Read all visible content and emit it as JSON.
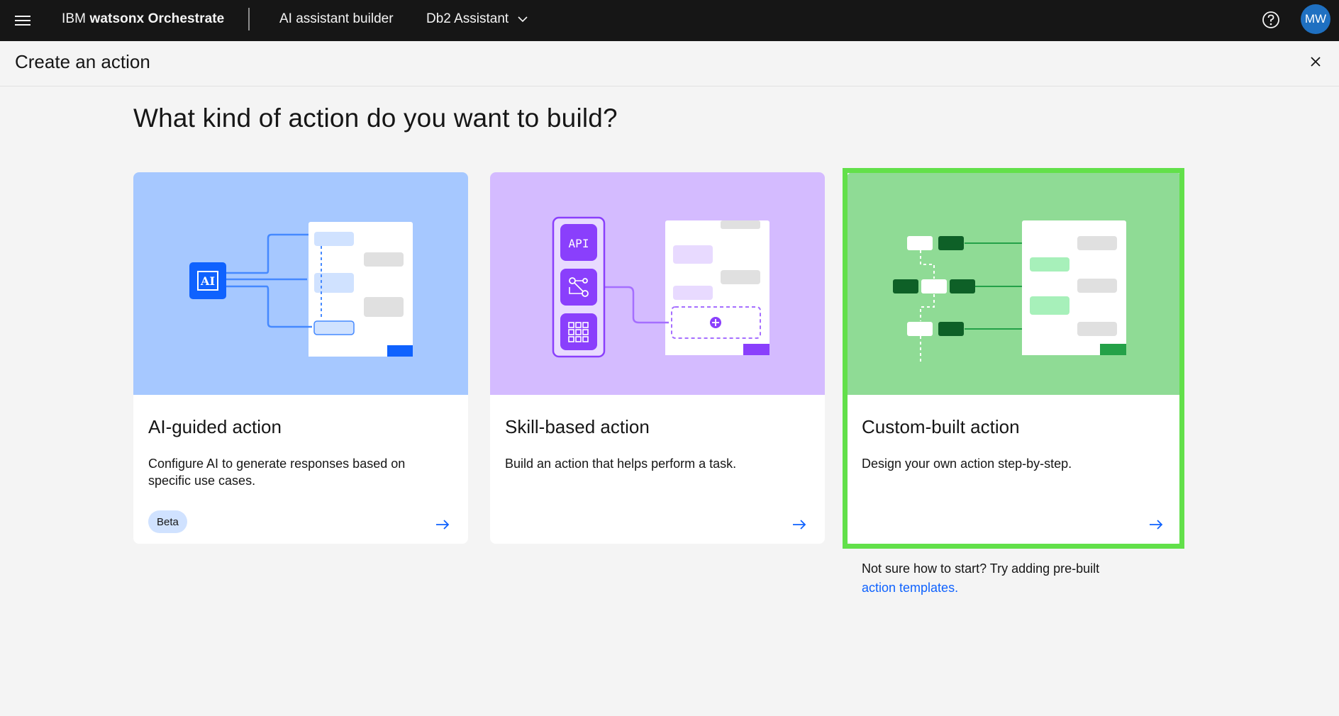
{
  "topbar": {
    "brand_prefix": "IBM",
    "brand_product": "watsonx Orchestrate",
    "nav_builder": "AI assistant builder",
    "nav_assistant": "Db2 Assistant",
    "avatar_initials": "MW",
    "icons": [
      "menu-icon",
      "chevron-down-icon",
      "help-icon"
    ],
    "background": "#161616"
  },
  "subheader": {
    "title": "Create an action"
  },
  "main": {
    "heading": "What kind of action do you want to build?",
    "cards": [
      {
        "title": "AI-guided action",
        "description": "Configure AI to generate responses based on specific use cases.",
        "badge": "Beta",
        "illustration_label": "AI",
        "color": "#a6c8ff"
      },
      {
        "title": "Skill-based action",
        "description": "Build an action that helps perform a task.",
        "illustration_label": "API",
        "color": "#d4bbff"
      },
      {
        "title": "Custom-built action",
        "description": "Design your own action step-by-step.",
        "color": "#8fdb95",
        "selected": true
      }
    ],
    "hint_text": "Not sure how to start? Try adding pre-built",
    "hint_link": "action templates."
  },
  "colors": {
    "accent": "#0f62fe",
    "highlight": "#62e04a"
  }
}
